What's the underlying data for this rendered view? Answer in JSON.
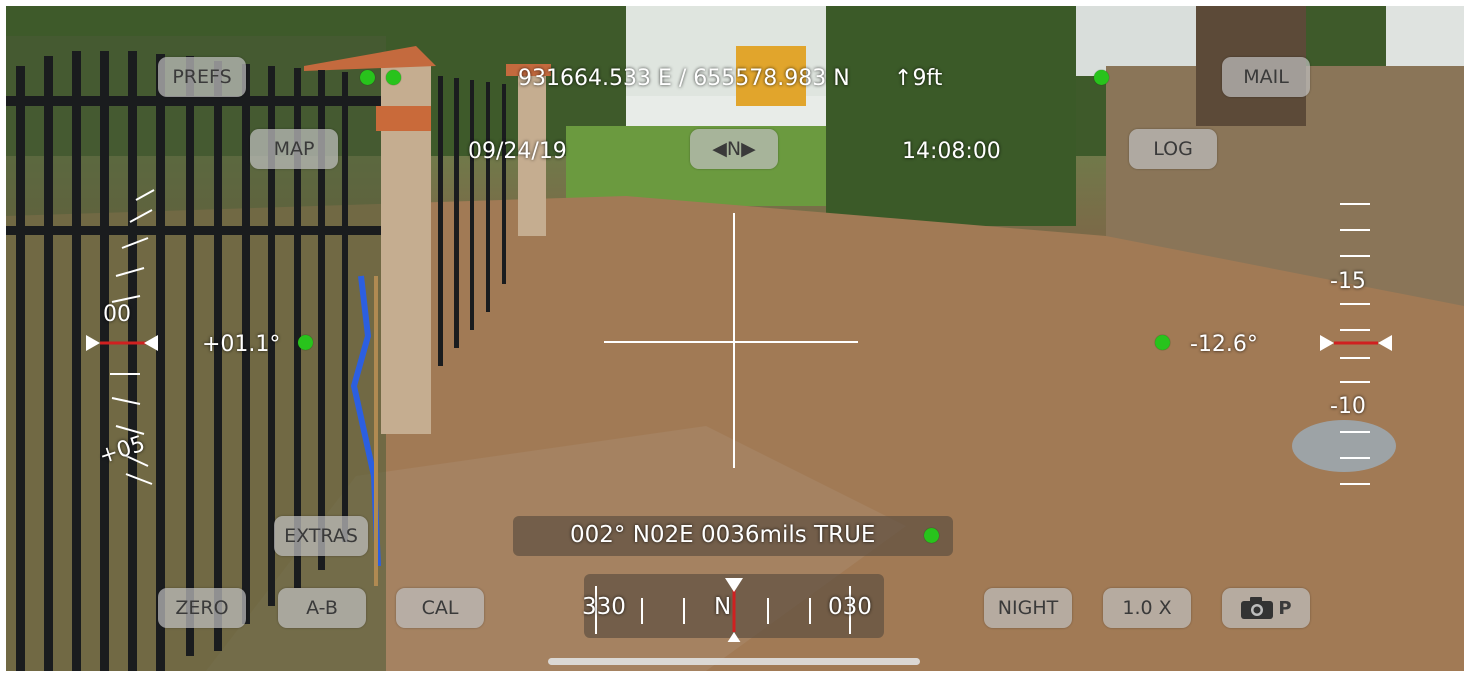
{
  "coordinates": "931664.533 E / 655578.983 N",
  "elevation": {
    "arrow": "↑",
    "value": "9ft"
  },
  "date": "09/24/19",
  "time": "14:08:00",
  "heading_mode": {
    "left": "◀",
    "label": "N",
    "right": "▶"
  },
  "pitch": "+01.1°",
  "roll": "-12.6°",
  "bearing": "002° N02E  0036mils  TRUE",
  "left_scale": {
    "label_top": "00",
    "label_bottom": "+05"
  },
  "right_scale": {
    "label_top": "-15",
    "label_bottom": "-10"
  },
  "compass": {
    "left": "330",
    "center": "N",
    "right": "030",
    "heading": 2
  },
  "buttons": {
    "prefs": "PREFS",
    "mail": "MAIL",
    "map": "MAP",
    "log": "LOG",
    "extras": "EXTRAS",
    "zero": "ZERO",
    "ab": "A-B",
    "cal": "CAL",
    "night": "NIGHT",
    "zoom": "1.0 X",
    "camera_mode": "P"
  },
  "icons": {
    "camera": "camera-icon",
    "heading_left": "left-arrow-icon",
    "heading_right": "right-arrow-icon",
    "elevation": "up-arrow-icon"
  },
  "colors": {
    "status_dot": "#28c31c",
    "indicator_line": "#d02020",
    "button_bg": "#bebebe"
  }
}
